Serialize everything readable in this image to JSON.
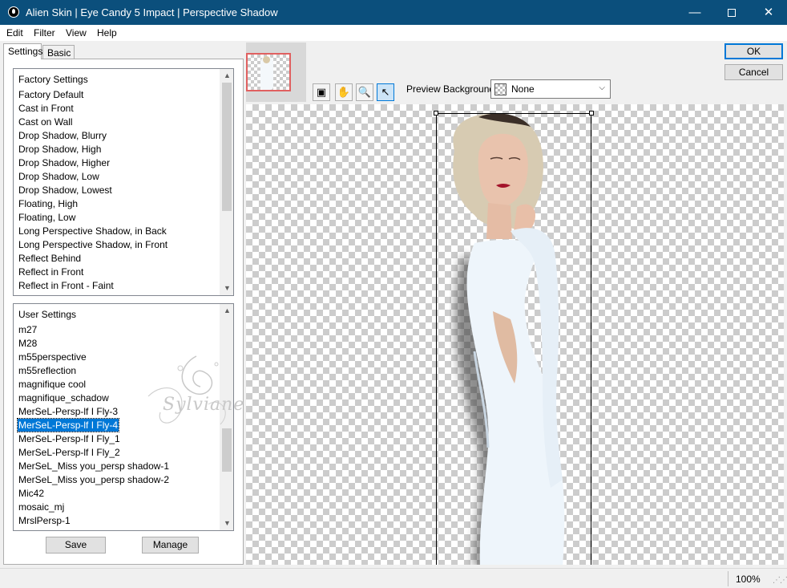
{
  "window": {
    "title": "Alien Skin | Eye Candy 5 Impact | Perspective Shadow",
    "minimize_glyph": "—",
    "close_glyph": "✕"
  },
  "menu": [
    "Edit",
    "Filter",
    "View",
    "Help"
  ],
  "tabs": {
    "settings": "Settings",
    "basic": "Basic"
  },
  "factory_settings": {
    "header": "Factory Settings",
    "items": [
      "Factory Default",
      "Cast in Front",
      "Cast on Wall",
      "Drop Shadow, Blurry",
      "Drop Shadow, High",
      "Drop Shadow, Higher",
      "Drop Shadow, Low",
      "Drop Shadow, Lowest",
      "Floating, High",
      "Floating, Low",
      "Long Perspective Shadow, in Back",
      "Long Perspective Shadow, in Front",
      "Reflect Behind",
      "Reflect in Front",
      "Reflect in Front - Faint"
    ],
    "scroll_position": 0.0
  },
  "user_settings": {
    "header": "User Settings",
    "items": [
      "m27",
      "M28",
      "m55perspective",
      "m55reflection",
      "magnifique cool",
      "magnifique_schadow",
      "MerSeL-Persp-lf I Fly-3",
      "MerSeL-Persp-lf I Fly-4",
      "MerSeL-Persp-lf I Fly_1",
      "MerSeL-Persp-lf I Fly_2",
      "MerSeL_Miss you_persp shadow-1",
      "MerSeL_Miss you_persp shadow-2",
      "Mic42",
      "mosaic_mj",
      "MrslPersp-1"
    ],
    "selected_index": 7
  },
  "watermark": "Sylviane",
  "buttons": {
    "save": "Save",
    "manage": "Manage",
    "ok": "OK",
    "cancel": "Cancel"
  },
  "tools": [
    "navigator-icon",
    "hand-icon",
    "zoom-icon",
    "pointer-icon"
  ],
  "tool_glyphs": {
    "navigator": "▣",
    "hand": "✋",
    "zoom": "🔍",
    "pointer": "↖"
  },
  "preview_background": {
    "label": "Preview Background:",
    "value": "None",
    "arrow": "⌵"
  },
  "status": {
    "zoom": "100%",
    "grip": "⋰⋰"
  },
  "colors": {
    "titlebar": "#0b4f7c",
    "selection": "#0078d7",
    "dress": "#eef5fb"
  }
}
